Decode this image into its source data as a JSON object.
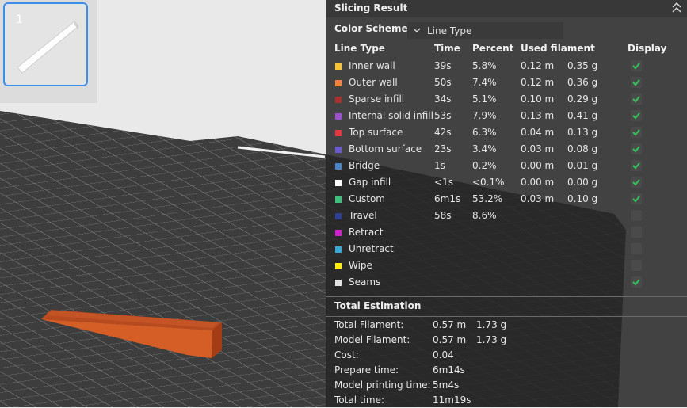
{
  "plate": {
    "number": "1"
  },
  "panel": {
    "title": "Slicing Result",
    "color_scheme_label": "Color Scheme",
    "color_scheme_value": "Line Type",
    "columns": [
      "Line Type",
      "Time",
      "Percent",
      "Used filament",
      "Display"
    ],
    "rows": [
      {
        "name": "Inner wall",
        "time": "39s",
        "percent": "5.8%",
        "length": "0.12 m",
        "weight": "0.35 g",
        "color": "#f6c431",
        "display": true
      },
      {
        "name": "Outer wall",
        "time": "50s",
        "percent": "7.4%",
        "length": "0.12 m",
        "weight": "0.36 g",
        "color": "#f7803a",
        "display": true
      },
      {
        "name": "Sparse infill",
        "time": "34s",
        "percent": "5.1%",
        "length": "0.10 m",
        "weight": "0.29 g",
        "color": "#a8302f",
        "display": true
      },
      {
        "name": "Internal solid infill",
        "time": "53s",
        "percent": "7.9%",
        "length": "0.13 m",
        "weight": "0.41 g",
        "color": "#9d4fd0",
        "display": true
      },
      {
        "name": "Top surface",
        "time": "42s",
        "percent": "6.3%",
        "length": "0.04 m",
        "weight": "0.13 g",
        "color": "#e8383f",
        "display": true
      },
      {
        "name": "Bottom surface",
        "time": "23s",
        "percent": "3.4%",
        "length": "0.03 m",
        "weight": "0.08 g",
        "color": "#6a5acd",
        "display": true
      },
      {
        "name": "Bridge",
        "time": "1s",
        "percent": "0.2%",
        "length": "0.00 m",
        "weight": "0.01 g",
        "color": "#4a85c8",
        "display": true
      },
      {
        "name": "Gap infill",
        "time": "<1s",
        "percent": "<0.1%",
        "length": "0.00 m",
        "weight": "0.00 g",
        "color": "#ffffff",
        "display": true
      },
      {
        "name": "Custom",
        "time": "6m1s",
        "percent": "53.2%",
        "length": "0.03 m",
        "weight": "0.10 g",
        "color": "#3cbf7a",
        "display": true
      },
      {
        "name": "Travel",
        "time": "58s",
        "percent": "8.6%",
        "length": "",
        "weight": "",
        "color": "#2e3f9a",
        "display": false
      },
      {
        "name": "Retract",
        "time": "",
        "percent": "",
        "length": "",
        "weight": "",
        "color": "#d21fd2",
        "display": false
      },
      {
        "name": "Unretract",
        "time": "",
        "percent": "",
        "length": "",
        "weight": "",
        "color": "#3aa8d6",
        "display": false
      },
      {
        "name": "Wipe",
        "time": "",
        "percent": "",
        "length": "",
        "weight": "",
        "color": "#ffee00",
        "display": false
      },
      {
        "name": "Seams",
        "time": "",
        "percent": "",
        "length": "",
        "weight": "",
        "color": "#e2e2e2",
        "display": true
      }
    ],
    "estimation_title": "Total Estimation",
    "estimation": [
      {
        "label": "Total Filament:",
        "value": "0.57 m",
        "extra": "1.73 g"
      },
      {
        "label": "Model Filament:",
        "value": "0.57 m",
        "extra": "1.73 g"
      },
      {
        "label": "Cost:",
        "value": "0.04",
        "extra": ""
      },
      {
        "label": "Prepare time:",
        "value": "6m14s",
        "extra": ""
      },
      {
        "label": "Model printing time:",
        "value": "5m4s",
        "extra": ""
      },
      {
        "label": "Total time:",
        "value": "11m19s",
        "extra": ""
      }
    ]
  },
  "colors": {
    "accent": "#3b8fe8",
    "check": "#2fc45a",
    "model": "#c8541c"
  }
}
